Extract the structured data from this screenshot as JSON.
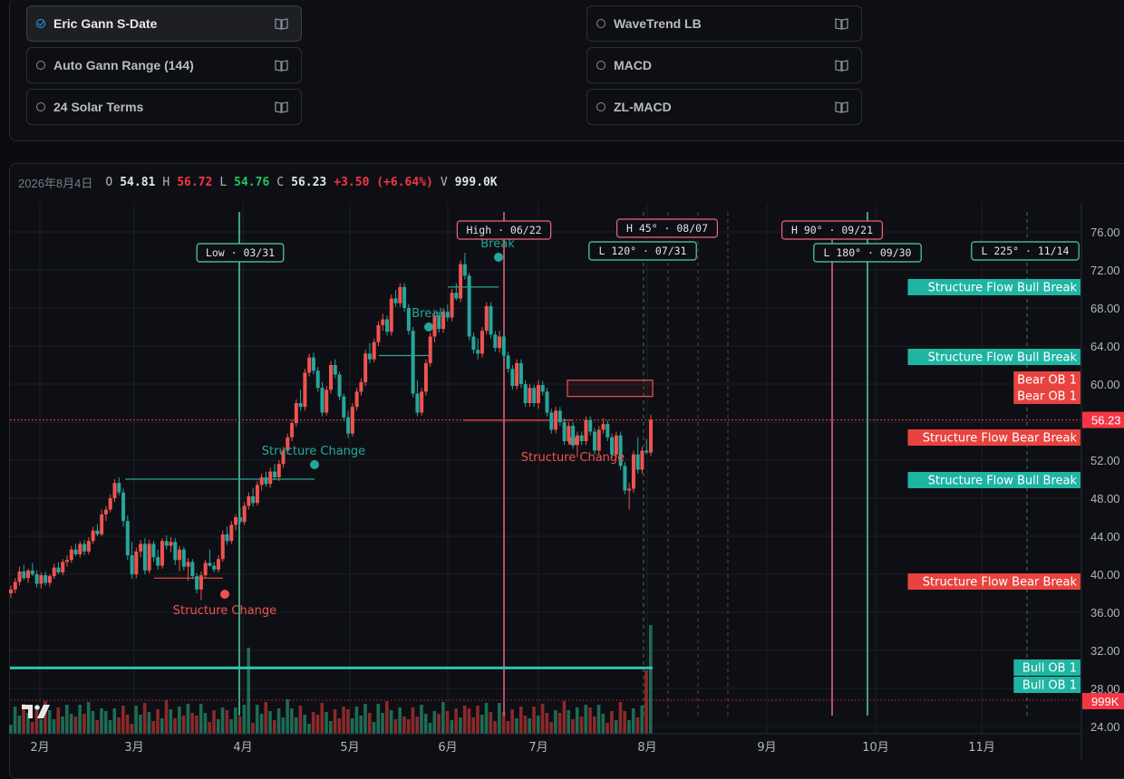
{
  "indicators_left": [
    {
      "label": "Eric Gann S-Date",
      "active": true
    },
    {
      "label": "Auto Gann Range (144)",
      "active": false
    },
    {
      "label": "24 Solar Terms",
      "active": false
    }
  ],
  "indicators_right": [
    {
      "label": "WaveTrend LB",
      "active": false
    },
    {
      "label": "MACD",
      "active": false
    },
    {
      "label": "ZL-MACD",
      "active": false
    }
  ],
  "ohlc": {
    "date": "2026年8月4日",
    "o_label": "O",
    "o": "54.81",
    "h_label": "H",
    "h": "56.72",
    "l_label": "L",
    "l": "54.76",
    "c_label": "C",
    "c": "56.23",
    "change": "+3.50 (+6.64%)",
    "v_label": "V",
    "v": "999.0K"
  },
  "colors": {
    "bull": "#26a69a",
    "bear": "#ef5350",
    "accent": "#2f9cf0",
    "price_line": "#f23645"
  },
  "chart_data": {
    "type": "candlestick",
    "y_ticks": [
      "76.00",
      "72.00",
      "68.00",
      "64.00",
      "60.00",
      "56.00",
      "52.00",
      "48.00",
      "44.00",
      "40.00",
      "36.00",
      "32.00",
      "28.00",
      "24.00"
    ],
    "x_ticks": [
      "2月",
      "3月",
      "4月",
      "5月",
      "6月",
      "7月",
      "8月",
      "9月",
      "10月",
      "11月"
    ],
    "last_price": "56.23",
    "volume_label": "999K",
    "gann_labels": [
      {
        "text": "Low · 03/31",
        "kind": "bull"
      },
      {
        "text": "High · 06/22",
        "kind": "bear"
      },
      {
        "text": "H 45° · 08/07",
        "kind": "bear"
      },
      {
        "text": "L 120° · 07/31",
        "kind": "bull"
      },
      {
        "text": "H 90° · 09/21",
        "kind": "bear"
      },
      {
        "text": "L 180° · 09/30",
        "kind": "bull"
      },
      {
        "text": "L 225° · 11/14",
        "kind": "bull"
      }
    ],
    "annotations": [
      {
        "text": "Structure Change",
        "kind": "bull"
      },
      {
        "text": "Break",
        "kind": "bull"
      },
      {
        "text": "Break",
        "kind": "bull"
      },
      {
        "text": "Structure Change",
        "kind": "bear"
      },
      {
        "text": "Structure Change",
        "kind": "bear"
      }
    ],
    "side_labels": [
      {
        "text": "Structure Flow Bull Break",
        "kind": "bull",
        "price": 70.0
      },
      {
        "text": "Structure Flow Bull Break",
        "kind": "bull",
        "price": 62.6
      },
      {
        "text": "Bear OB 1",
        "kind": "bear",
        "price": 60.3
      },
      {
        "text": "Bear OB 1",
        "kind": "bear",
        "price": 58.6
      },
      {
        "text": "Structure Flow Bear Break",
        "kind": "bear",
        "price": 54.9
      },
      {
        "text": "Structure Flow Bull Break",
        "kind": "bull",
        "price": 49.6
      },
      {
        "text": "Structure Flow Bear Break",
        "kind": "bear",
        "price": 38.9
      },
      {
        "text": "Bull OB 1",
        "kind": "bull",
        "price": 30.1
      },
      {
        "text": "Bull OB 1",
        "kind": "bull",
        "price": 28.3
      }
    ],
    "candles": [
      [
        38.0,
        38.8,
        37.5,
        38.4
      ],
      [
        38.4,
        39.6,
        38.0,
        39.2
      ],
      [
        39.2,
        40.8,
        38.8,
        40.3
      ],
      [
        40.3,
        41.0,
        39.4,
        39.6
      ],
      [
        39.6,
        40.6,
        39.1,
        40.4
      ],
      [
        40.4,
        41.2,
        39.8,
        40.0
      ],
      [
        40.0,
        40.4,
        38.6,
        39.0
      ],
      [
        39.0,
        40.2,
        38.5,
        39.9
      ],
      [
        39.9,
        40.3,
        38.8,
        39.1
      ],
      [
        39.1,
        40.0,
        38.7,
        39.8
      ],
      [
        39.8,
        41.1,
        39.5,
        40.7
      ],
      [
        40.7,
        41.3,
        40.0,
        40.2
      ],
      [
        40.2,
        41.6,
        39.9,
        41.3
      ],
      [
        41.3,
        42.0,
        40.8,
        41.5
      ],
      [
        41.5,
        43.0,
        41.2,
        42.6
      ],
      [
        42.6,
        43.2,
        41.9,
        42.1
      ],
      [
        42.1,
        43.5,
        41.8,
        43.2
      ],
      [
        43.2,
        43.6,
        42.0,
        42.4
      ],
      [
        42.4,
        43.9,
        42.1,
        43.5
      ],
      [
        43.5,
        45.0,
        43.2,
        44.6
      ],
      [
        44.6,
        45.3,
        44.0,
        44.2
      ],
      [
        44.2,
        46.8,
        44.0,
        46.3
      ],
      [
        46.3,
        47.2,
        45.6,
        46.8
      ],
      [
        46.8,
        48.4,
        46.5,
        48.0
      ],
      [
        48.0,
        50.0,
        47.6,
        49.6
      ],
      [
        49.6,
        50.2,
        48.3,
        48.6
      ],
      [
        48.6,
        49.0,
        45.0,
        45.6
      ],
      [
        45.6,
        46.2,
        41.5,
        42.0
      ],
      [
        42.0,
        43.4,
        39.5,
        40.0
      ],
      [
        40.0,
        42.8,
        39.6,
        42.4
      ],
      [
        42.4,
        43.6,
        41.8,
        43.2
      ],
      [
        43.2,
        43.8,
        40.0,
        40.4
      ],
      [
        40.4,
        43.6,
        40.1,
        43.2
      ],
      [
        43.2,
        43.5,
        41.3,
        41.8
      ],
      [
        41.8,
        42.6,
        40.5,
        40.9
      ],
      [
        40.9,
        43.8,
        40.6,
        43.5
      ],
      [
        43.5,
        44.1,
        42.6,
        43.0
      ],
      [
        43.0,
        43.9,
        42.3,
        43.4
      ],
      [
        43.4,
        43.8,
        41.0,
        41.5
      ],
      [
        41.5,
        43.0,
        40.3,
        42.6
      ],
      [
        42.6,
        42.9,
        40.4,
        40.8
      ],
      [
        40.8,
        41.7,
        39.3,
        41.3
      ],
      [
        41.3,
        41.6,
        39.5,
        39.8
      ],
      [
        39.8,
        40.1,
        38.0,
        38.4
      ],
      [
        38.4,
        40.3,
        37.3,
        39.9
      ],
      [
        39.9,
        41.5,
        39.6,
        41.2
      ],
      [
        41.2,
        42.6,
        40.8,
        40.9
      ],
      [
        40.9,
        41.3,
        40.2,
        40.5
      ],
      [
        40.5,
        42.0,
        40.2,
        41.6
      ],
      [
        41.6,
        44.6,
        41.3,
        44.2
      ],
      [
        44.2,
        45.0,
        43.1,
        43.5
      ],
      [
        43.5,
        45.6,
        43.2,
        45.2
      ],
      [
        45.2,
        46.3,
        44.6,
        46.0
      ],
      [
        46.0,
        47.0,
        45.3,
        45.5
      ],
      [
        45.5,
        47.6,
        45.2,
        47.2
      ],
      [
        47.2,
        48.6,
        46.8,
        48.2
      ],
      [
        48.2,
        49.1,
        47.1,
        47.5
      ],
      [
        47.5,
        49.8,
        47.2,
        49.4
      ],
      [
        49.4,
        50.6,
        48.8,
        50.2
      ],
      [
        50.2,
        50.8,
        49.2,
        49.5
      ],
      [
        49.5,
        51.2,
        49.1,
        50.8
      ],
      [
        50.8,
        51.6,
        49.9,
        50.2
      ],
      [
        50.2,
        52.0,
        49.8,
        51.6
      ],
      [
        51.6,
        53.4,
        51.2,
        53.0
      ],
      [
        53.0,
        54.8,
        52.6,
        54.4
      ],
      [
        54.4,
        56.3,
        54.0,
        55.9
      ],
      [
        55.9,
        58.4,
        55.5,
        58.0
      ],
      [
        58.0,
        59.4,
        57.2,
        57.6
      ],
      [
        57.6,
        61.6,
        57.2,
        61.2
      ],
      [
        61.2,
        63.2,
        60.8,
        62.8
      ],
      [
        62.8,
        63.3,
        61.0,
        61.4
      ],
      [
        61.4,
        61.8,
        59.2,
        59.6
      ],
      [
        59.6,
        60.2,
        56.6,
        57.0
      ],
      [
        57.0,
        59.8,
        56.7,
        59.4
      ],
      [
        59.4,
        62.4,
        59.0,
        62.0
      ],
      [
        62.0,
        62.6,
        60.6,
        61.0
      ],
      [
        61.0,
        61.3,
        58.3,
        58.7
      ],
      [
        58.7,
        59.0,
        56.1,
        56.5
      ],
      [
        56.5,
        57.2,
        54.3,
        54.8
      ],
      [
        54.8,
        58.0,
        54.5,
        57.6
      ],
      [
        57.6,
        59.6,
        57.2,
        59.2
      ],
      [
        59.2,
        60.6,
        58.8,
        60.2
      ],
      [
        60.2,
        63.6,
        59.8,
        63.2
      ],
      [
        63.2,
        64.3,
        62.2,
        62.6
      ],
      [
        62.6,
        64.8,
        62.3,
        64.4
      ],
      [
        64.4,
        66.6,
        64.0,
        66.2
      ],
      [
        66.2,
        67.4,
        65.6,
        66.8
      ],
      [
        66.8,
        67.2,
        65.1,
        65.5
      ],
      [
        65.5,
        69.4,
        65.1,
        69.0
      ],
      [
        69.0,
        69.9,
        68.1,
        68.5
      ],
      [
        68.5,
        70.6,
        68.1,
        70.2
      ],
      [
        70.2,
        70.6,
        67.6,
        68.0
      ],
      [
        68.0,
        68.4,
        65.2,
        65.6
      ],
      [
        65.6,
        66.0,
        58.6,
        59.0
      ],
      [
        59.0,
        60.4,
        56.6,
        57.0
      ],
      [
        57.0,
        59.6,
        56.7,
        59.2
      ],
      [
        59.2,
        62.6,
        58.8,
        62.2
      ],
      [
        62.2,
        65.4,
        61.8,
        65.0
      ],
      [
        65.0,
        67.6,
        64.4,
        67.2
      ],
      [
        67.2,
        67.6,
        65.4,
        65.8
      ],
      [
        65.8,
        68.0,
        65.4,
        67.6
      ],
      [
        67.6,
        68.4,
        66.6,
        67.0
      ],
      [
        67.0,
        70.0,
        66.6,
        69.6
      ],
      [
        69.6,
        70.6,
        68.8,
        69.0
      ],
      [
        69.0,
        73.0,
        68.6,
        72.6
      ],
      [
        72.6,
        73.8,
        71.0,
        71.4
      ],
      [
        71.4,
        71.7,
        64.6,
        65.0
      ],
      [
        65.0,
        65.4,
        63.2,
        63.6
      ],
      [
        63.6,
        64.8,
        62.6,
        63.2
      ],
      [
        63.2,
        66.0,
        62.8,
        65.6
      ],
      [
        65.6,
        68.6,
        65.2,
        68.2
      ],
      [
        68.2,
        68.6,
        64.8,
        65.2
      ],
      [
        65.2,
        65.6,
        63.4,
        63.8
      ],
      [
        63.8,
        65.6,
        63.3,
        65.0
      ],
      [
        65.0,
        65.4,
        62.6,
        63.0
      ],
      [
        63.0,
        63.4,
        61.2,
        61.6
      ],
      [
        61.6,
        62.0,
        59.4,
        59.8
      ],
      [
        59.8,
        62.6,
        59.4,
        62.2
      ],
      [
        62.2,
        62.6,
        59.6,
        60.0
      ],
      [
        60.0,
        60.4,
        57.6,
        58.0
      ],
      [
        58.0,
        60.0,
        57.6,
        59.6
      ],
      [
        59.6,
        59.9,
        57.6,
        58.0
      ],
      [
        58.0,
        60.4,
        57.4,
        59.9
      ],
      [
        59.9,
        60.3,
        58.8,
        59.2
      ],
      [
        59.2,
        59.6,
        56.6,
        57.0
      ],
      [
        57.0,
        57.4,
        54.8,
        55.2
      ],
      [
        55.2,
        57.6,
        54.8,
        57.2
      ],
      [
        57.2,
        57.6,
        55.6,
        56.0
      ],
      [
        56.0,
        56.4,
        53.6,
        54.0
      ],
      [
        54.0,
        56.0,
        53.6,
        55.6
      ],
      [
        55.6,
        56.0,
        53.2,
        53.6
      ],
      [
        53.6,
        55.0,
        52.3,
        54.6
      ],
      [
        54.6,
        55.0,
        53.6,
        54.0
      ],
      [
        54.0,
        56.6,
        53.6,
        56.2
      ],
      [
        56.2,
        56.6,
        54.6,
        55.0
      ],
      [
        55.0,
        55.4,
        52.6,
        53.0
      ],
      [
        53.0,
        55.6,
        52.6,
        55.2
      ],
      [
        55.2,
        56.4,
        54.8,
        55.8
      ],
      [
        55.8,
        56.2,
        54.0,
        54.4
      ],
      [
        54.4,
        54.8,
        52.2,
        52.6
      ],
      [
        52.6,
        55.0,
        52.2,
        54.6
      ],
      [
        54.6,
        55.0,
        51.0,
        51.4
      ],
      [
        51.4,
        51.8,
        48.4,
        48.8
      ],
      [
        48.8,
        49.6,
        46.8,
        49.0
      ],
      [
        49.0,
        53.0,
        48.6,
        52.6
      ],
      [
        52.6,
        54.4,
        50.6,
        51.0
      ],
      [
        51.0,
        53.4,
        50.6,
        53.0
      ],
      [
        53.0,
        54.2,
        52.6,
        52.8
      ],
      [
        52.8,
        56.8,
        52.4,
        56.23
      ]
    ]
  }
}
